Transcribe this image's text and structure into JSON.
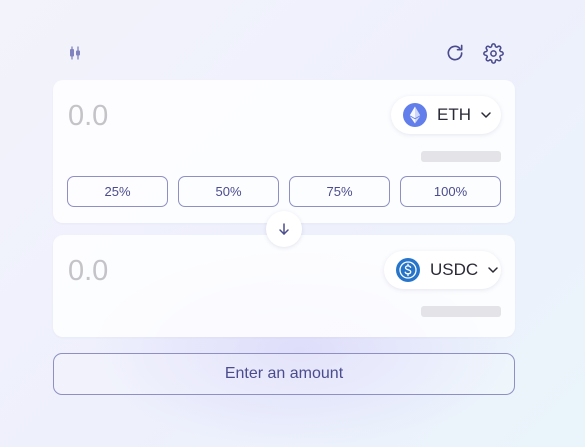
{
  "toolbar": {
    "chart_icon": "candlestick-chart-icon",
    "refresh_icon": "refresh-icon",
    "settings_icon": "gear-icon"
  },
  "from": {
    "amount_placeholder": "0.0",
    "token": {
      "symbol": "ETH",
      "icon": "ethereum-logo-icon",
      "color": "#627eea"
    },
    "percent_buttons": [
      "25%",
      "50%",
      "75%",
      "100%"
    ]
  },
  "switch": {
    "icon": "arrow-down-icon"
  },
  "to": {
    "amount_placeholder": "0.0",
    "token": {
      "symbol": "USDC",
      "icon": "usdc-logo-icon",
      "color": "#2775ca"
    }
  },
  "submit": {
    "label": "Enter an amount"
  },
  "colors": {
    "accent": "#4b4c8e",
    "border": "#8e8fc2",
    "skeleton": "#e4e4e8",
    "placeholder": "#c4c4c8"
  }
}
